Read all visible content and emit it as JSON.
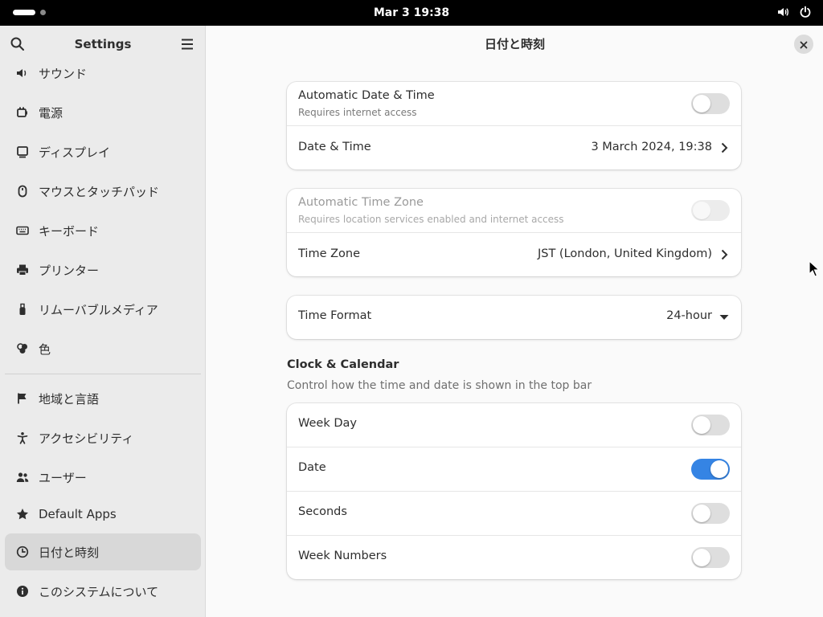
{
  "topbar": {
    "clock": "Mar 3  19:38",
    "icons": [
      "activities-indicator",
      "volume-icon",
      "power-icon"
    ]
  },
  "sidebar": {
    "title": "Settings",
    "icons": {
      "search": "search-icon",
      "menu": "hamburger-menu-icon"
    },
    "items": [
      {
        "label": "サウンド",
        "icon": "speaker-icon"
      },
      {
        "label": "電源",
        "icon": "battery-icon"
      },
      {
        "label": "ディスプレイ",
        "icon": "display-icon"
      },
      {
        "label": "マウスとタッチパッド",
        "icon": "mouse-icon"
      },
      {
        "label": "キーボード",
        "icon": "keyboard-icon"
      },
      {
        "label": "プリンター",
        "icon": "printer-icon"
      },
      {
        "label": "リムーバブルメディア",
        "icon": "usb-icon"
      },
      {
        "label": "色",
        "icon": "color-icon"
      },
      {
        "label": "地域と言語",
        "icon": "flag-icon"
      },
      {
        "label": "アクセシビリティ",
        "icon": "accessibility-icon"
      },
      {
        "label": "ユーザー",
        "icon": "users-icon"
      },
      {
        "label": "Default Apps",
        "icon": "star-icon"
      },
      {
        "label": "日付と時刻",
        "icon": "clock-icon",
        "selected": true
      },
      {
        "label": "このシステムについて",
        "icon": "info-icon"
      }
    ]
  },
  "main": {
    "title": "日付と時刻",
    "auto_date_time": {
      "title": "Automatic Date & Time",
      "subtitle": "Requires internet access",
      "enabled": false
    },
    "date_time": {
      "title": "Date & Time",
      "value": "3 March 2024, 19:38"
    },
    "auto_time_zone": {
      "title": "Automatic Time Zone",
      "subtitle": "Requires location services enabled and internet access",
      "enabled": false,
      "disabled": true
    },
    "time_zone": {
      "title": "Time Zone",
      "value": "JST (London, United Kingdom)"
    },
    "time_format": {
      "title": "Time Format",
      "value": "24-hour"
    },
    "clock_calendar": {
      "title": "Clock & Calendar",
      "description": "Control how the time and date is shown in the top bar",
      "rows": [
        {
          "title": "Week Day",
          "enabled": false
        },
        {
          "title": "Date",
          "enabled": true
        },
        {
          "title": "Seconds",
          "enabled": false
        },
        {
          "title": "Week Numbers",
          "enabled": false
        }
      ]
    }
  },
  "colors": {
    "accent": "#3584e4",
    "sidebar_bg": "#ebebeb",
    "selected_bg": "#d8d8d8"
  }
}
